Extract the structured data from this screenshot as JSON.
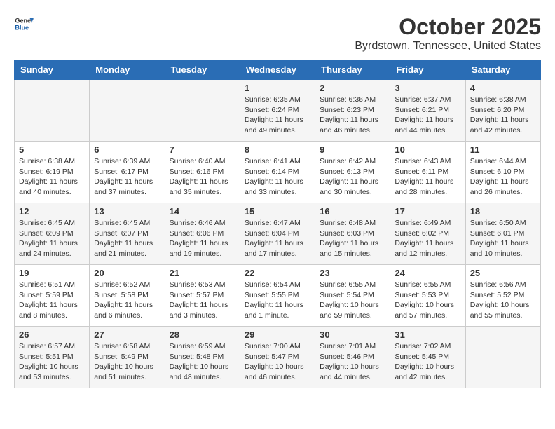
{
  "header": {
    "logo_general": "General",
    "logo_blue": "Blue",
    "month": "October 2025",
    "location": "Byrdstown, Tennessee, United States"
  },
  "days_of_week": [
    "Sunday",
    "Monday",
    "Tuesday",
    "Wednesday",
    "Thursday",
    "Friday",
    "Saturday"
  ],
  "weeks": [
    [
      {
        "day": "",
        "info": ""
      },
      {
        "day": "",
        "info": ""
      },
      {
        "day": "",
        "info": ""
      },
      {
        "day": "1",
        "info": "Sunrise: 6:35 AM\nSunset: 6:24 PM\nDaylight: 11 hours\nand 49 minutes."
      },
      {
        "day": "2",
        "info": "Sunrise: 6:36 AM\nSunset: 6:23 PM\nDaylight: 11 hours\nand 46 minutes."
      },
      {
        "day": "3",
        "info": "Sunrise: 6:37 AM\nSunset: 6:21 PM\nDaylight: 11 hours\nand 44 minutes."
      },
      {
        "day": "4",
        "info": "Sunrise: 6:38 AM\nSunset: 6:20 PM\nDaylight: 11 hours\nand 42 minutes."
      }
    ],
    [
      {
        "day": "5",
        "info": "Sunrise: 6:38 AM\nSunset: 6:19 PM\nDaylight: 11 hours\nand 40 minutes."
      },
      {
        "day": "6",
        "info": "Sunrise: 6:39 AM\nSunset: 6:17 PM\nDaylight: 11 hours\nand 37 minutes."
      },
      {
        "day": "7",
        "info": "Sunrise: 6:40 AM\nSunset: 6:16 PM\nDaylight: 11 hours\nand 35 minutes."
      },
      {
        "day": "8",
        "info": "Sunrise: 6:41 AM\nSunset: 6:14 PM\nDaylight: 11 hours\nand 33 minutes."
      },
      {
        "day": "9",
        "info": "Sunrise: 6:42 AM\nSunset: 6:13 PM\nDaylight: 11 hours\nand 30 minutes."
      },
      {
        "day": "10",
        "info": "Sunrise: 6:43 AM\nSunset: 6:11 PM\nDaylight: 11 hours\nand 28 minutes."
      },
      {
        "day": "11",
        "info": "Sunrise: 6:44 AM\nSunset: 6:10 PM\nDaylight: 11 hours\nand 26 minutes."
      }
    ],
    [
      {
        "day": "12",
        "info": "Sunrise: 6:45 AM\nSunset: 6:09 PM\nDaylight: 11 hours\nand 24 minutes."
      },
      {
        "day": "13",
        "info": "Sunrise: 6:45 AM\nSunset: 6:07 PM\nDaylight: 11 hours\nand 21 minutes."
      },
      {
        "day": "14",
        "info": "Sunrise: 6:46 AM\nSunset: 6:06 PM\nDaylight: 11 hours\nand 19 minutes."
      },
      {
        "day": "15",
        "info": "Sunrise: 6:47 AM\nSunset: 6:04 PM\nDaylight: 11 hours\nand 17 minutes."
      },
      {
        "day": "16",
        "info": "Sunrise: 6:48 AM\nSunset: 6:03 PM\nDaylight: 11 hours\nand 15 minutes."
      },
      {
        "day": "17",
        "info": "Sunrise: 6:49 AM\nSunset: 6:02 PM\nDaylight: 11 hours\nand 12 minutes."
      },
      {
        "day": "18",
        "info": "Sunrise: 6:50 AM\nSunset: 6:01 PM\nDaylight: 11 hours\nand 10 minutes."
      }
    ],
    [
      {
        "day": "19",
        "info": "Sunrise: 6:51 AM\nSunset: 5:59 PM\nDaylight: 11 hours\nand 8 minutes."
      },
      {
        "day": "20",
        "info": "Sunrise: 6:52 AM\nSunset: 5:58 PM\nDaylight: 11 hours\nand 6 minutes."
      },
      {
        "day": "21",
        "info": "Sunrise: 6:53 AM\nSunset: 5:57 PM\nDaylight: 11 hours\nand 3 minutes."
      },
      {
        "day": "22",
        "info": "Sunrise: 6:54 AM\nSunset: 5:55 PM\nDaylight: 11 hours\nand 1 minute."
      },
      {
        "day": "23",
        "info": "Sunrise: 6:55 AM\nSunset: 5:54 PM\nDaylight: 10 hours\nand 59 minutes."
      },
      {
        "day": "24",
        "info": "Sunrise: 6:55 AM\nSunset: 5:53 PM\nDaylight: 10 hours\nand 57 minutes."
      },
      {
        "day": "25",
        "info": "Sunrise: 6:56 AM\nSunset: 5:52 PM\nDaylight: 10 hours\nand 55 minutes."
      }
    ],
    [
      {
        "day": "26",
        "info": "Sunrise: 6:57 AM\nSunset: 5:51 PM\nDaylight: 10 hours\nand 53 minutes."
      },
      {
        "day": "27",
        "info": "Sunrise: 6:58 AM\nSunset: 5:49 PM\nDaylight: 10 hours\nand 51 minutes."
      },
      {
        "day": "28",
        "info": "Sunrise: 6:59 AM\nSunset: 5:48 PM\nDaylight: 10 hours\nand 48 minutes."
      },
      {
        "day": "29",
        "info": "Sunrise: 7:00 AM\nSunset: 5:47 PM\nDaylight: 10 hours\nand 46 minutes."
      },
      {
        "day": "30",
        "info": "Sunrise: 7:01 AM\nSunset: 5:46 PM\nDaylight: 10 hours\nand 44 minutes."
      },
      {
        "day": "31",
        "info": "Sunrise: 7:02 AM\nSunset: 5:45 PM\nDaylight: 10 hours\nand 42 minutes."
      },
      {
        "day": "",
        "info": ""
      }
    ]
  ]
}
